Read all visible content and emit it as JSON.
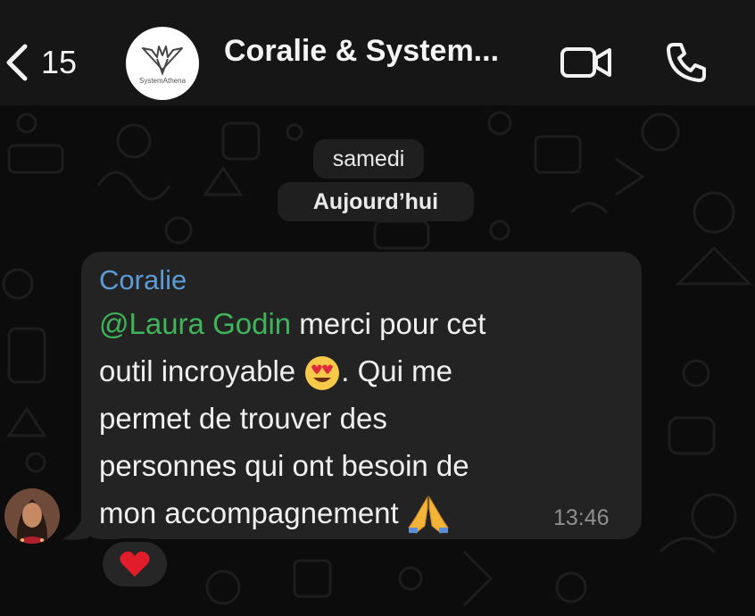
{
  "header": {
    "back_count": "15",
    "title": "Coralie & System...",
    "avatar_brand": "SystemAthena",
    "icons": {
      "back": "chevron-left-icon",
      "video": "video-camera-icon",
      "call": "phone-icon"
    }
  },
  "chat": {
    "date_separators": [
      "samedi",
      "Aujourd’hui"
    ],
    "message": {
      "sender": "Coralie",
      "mention": "@Laura Godin",
      "lines": [
        " merci pour cet",
        "outil incroyable ",
        ". Qui me",
        "permet de trouver des",
        "personnes qui ont besoin de",
        "mon accompagnement "
      ],
      "emojis": [
        "heart-eyes-emoji",
        "folded-hands-emoji"
      ],
      "time": "13:46",
      "reaction": "red-heart-emoji"
    }
  },
  "colors": {
    "background": "#0c0c0c",
    "header": "#161616",
    "bubble": "#232323",
    "sender": "#5c9bd6",
    "mention": "#3fb45a",
    "timestamp": "#8f8f8f"
  }
}
